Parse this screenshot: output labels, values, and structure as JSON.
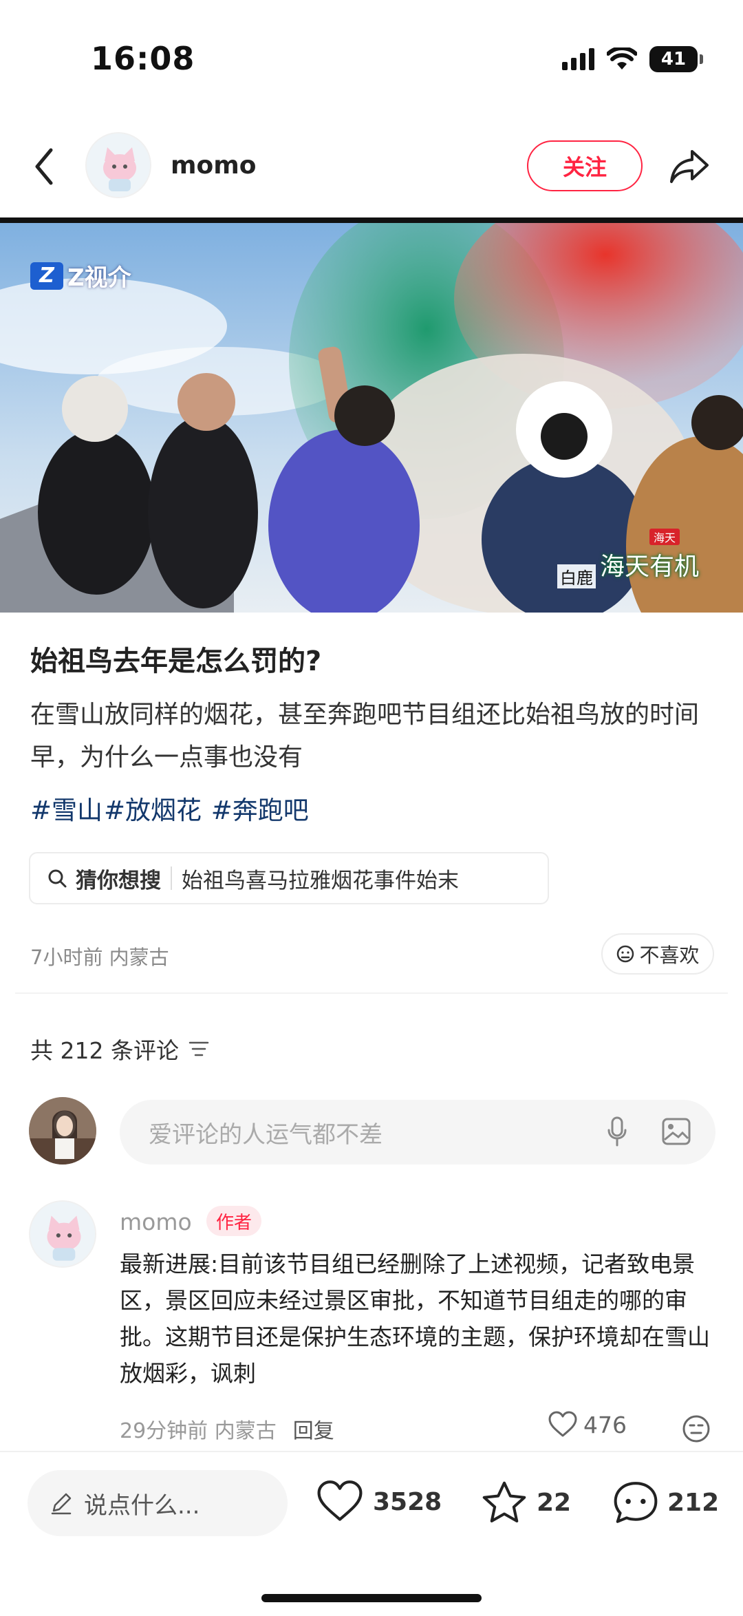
{
  "status_bar": {
    "time": "16:08",
    "battery": "41",
    "icons": [
      "signal-icon",
      "wifi-icon",
      "battery-icon"
    ]
  },
  "header": {
    "author_name": "momo",
    "follow_label": "关注",
    "icons": [
      "back-icon",
      "share-icon"
    ]
  },
  "media": {
    "channel_logo_text": "Z视介",
    "logo_mark": "Z",
    "sponsor_small": "海天",
    "sponsor": "海天有机",
    "jacket_text": "白鹿"
  },
  "post": {
    "title": "始祖鸟去年是怎么罚的?",
    "body": "在雪山放同样的烟花，甚至奔跑吧节目组还比始祖鸟放的时间早，为什么一点事也没有",
    "tags": [
      "#雪山",
      "#放烟花",
      " #奔跑吧"
    ],
    "guess_label": "猜你想搜",
    "guess_query": "始祖鸟喜马拉雅烟花事件始末",
    "meta": "7小时前 内蒙古",
    "dislike_label": "不喜欢"
  },
  "comments": {
    "count_label": "共 212 条评论",
    "input_placeholder": "爱评论的人运气都不差",
    "items": [
      {
        "author": "momo",
        "badge": "作者",
        "text": "最新进展:目前该节目组已经删除了上述视频，记者致电景区，景区回应未经过景区审批，不知道节目组走的哪的审批。这期节目还是保护生态环境的主题，保护环境却在雪山放烟彩，讽刺",
        "time_location": "29分钟前 内蒙古",
        "reply_label": "回复",
        "likes": "476"
      }
    ]
  },
  "bottom_bar": {
    "input_placeholder": "说点什么...",
    "likes": "3528",
    "favorites": "22",
    "comments": "212"
  },
  "colors": {
    "accent": "#ff2442",
    "tag": "#13386c",
    "muted": "#999999"
  }
}
